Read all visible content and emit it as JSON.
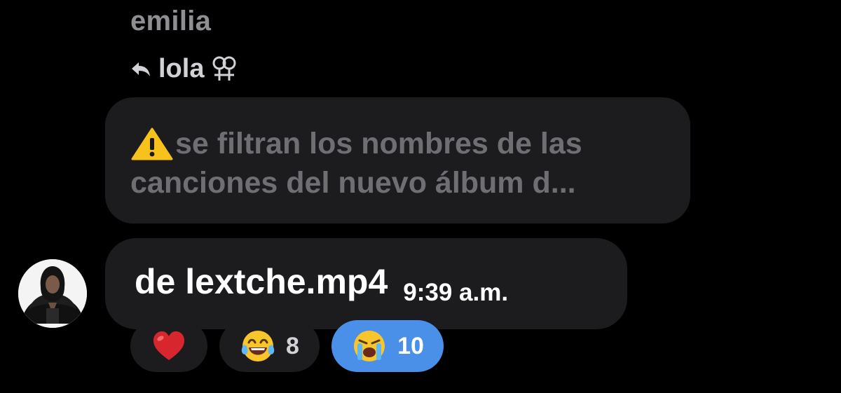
{
  "sender": {
    "name": "emilia"
  },
  "reply": {
    "icon": "reply-arrow-icon",
    "to_name": "lola",
    "symbol": "⚢",
    "symbol_icon": "double-female-symbol-icon"
  },
  "quoted_message": {
    "icon": "warning-icon",
    "line1": "se filtran los nombres de las",
    "line2": "canciones del nuevo álbum d..."
  },
  "message": {
    "text": "de lextche.mp4",
    "time": "9:39 a.m."
  },
  "reactions": [
    {
      "emoji": "❤️",
      "icon": "red-heart-icon",
      "count": "",
      "selected": false
    },
    {
      "emoji": "😂",
      "icon": "face-with-tears-of-joy-icon",
      "count": "8",
      "selected": false
    },
    {
      "emoji": "😭",
      "icon": "loudly-crying-face-icon",
      "count": "10",
      "selected": true
    }
  ],
  "colors": {
    "background": "#000000",
    "bubble": "#1c1c1e",
    "muted_text": "#8e8e93",
    "quoted_text": "#6e6e73",
    "selected_reaction": "#4a8fe8"
  }
}
